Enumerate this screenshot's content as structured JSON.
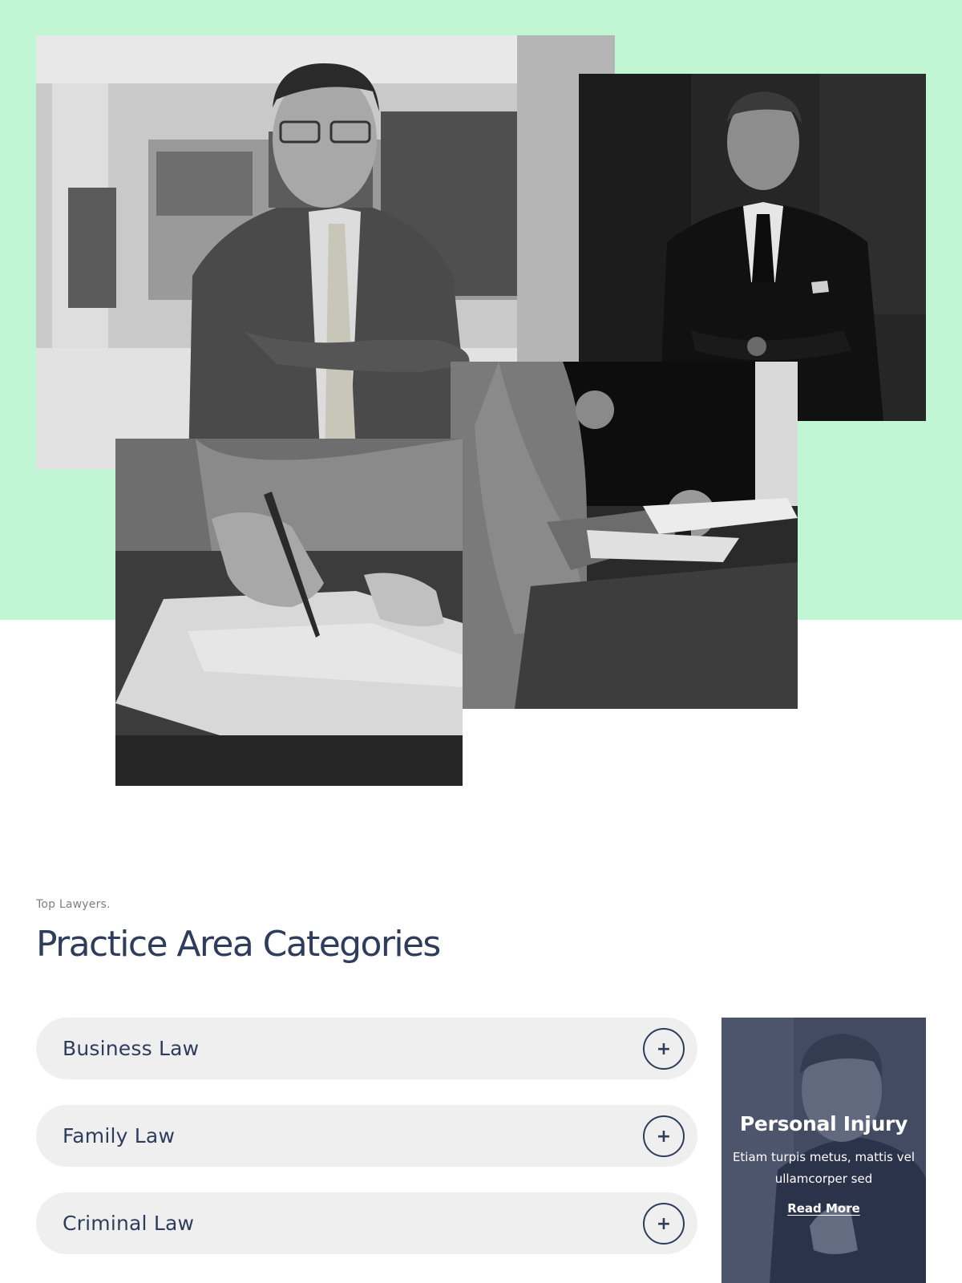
{
  "gallery": {
    "images": [
      {
        "name": "lawyer-portrait-glasses",
        "alt": ""
      },
      {
        "name": "lawyer-portrait-dark-suit",
        "alt": ""
      },
      {
        "name": "hand-signing-document",
        "alt": ""
      },
      {
        "name": "meeting-at-table",
        "alt": ""
      }
    ]
  },
  "section": {
    "eyebrow": "Top Lawyers.",
    "heading": "Practice Area Categories"
  },
  "accordion": {
    "items": [
      {
        "label": "Business Law",
        "toggle_icon": "+"
      },
      {
        "label": "Family Law",
        "toggle_icon": "+"
      },
      {
        "label": "Criminal Law",
        "toggle_icon": "+"
      }
    ]
  },
  "promo": {
    "title": "Personal Injury",
    "text": "Etiam turpis metus, mattis vel ullamcorper sed",
    "link": "Read More"
  },
  "colors": {
    "mint": "#c0f6d3",
    "navy": "#2f3d5c",
    "accordion_bg": "#efefef",
    "muted": "#7b7f86"
  }
}
